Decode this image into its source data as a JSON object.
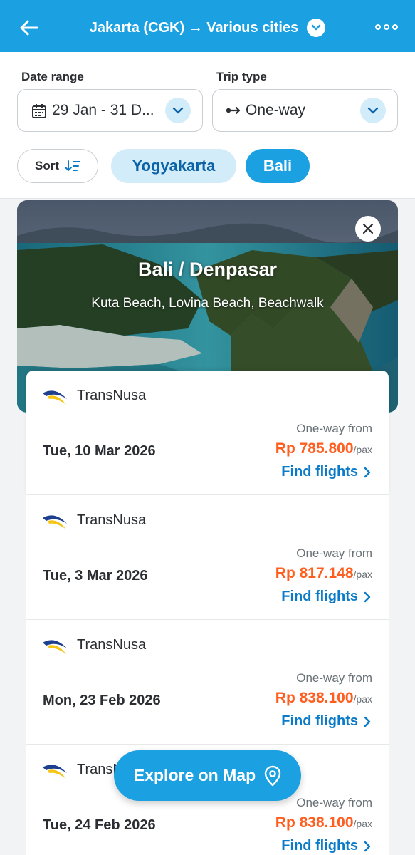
{
  "header": {
    "title": "Jakarta (CGK) → Various cities",
    "back_icon": "arrow-left-icon",
    "more_icon": "more-horizontal-icon",
    "bg_color": "#1ba0e2"
  },
  "filters": {
    "date_range_label": "Date range",
    "date_range_value": "29 Jan - 31 D...",
    "trip_type_label": "Trip type",
    "trip_type_value": "One-way",
    "sort_label": "Sort",
    "chips": [
      "Yogyakarta",
      "Bali"
    ],
    "selected_chip": "Bali"
  },
  "destination": {
    "title": "Bali / Denpasar",
    "subtitle": "Kuta Beach, Lovina Beach, Beachwalk"
  },
  "results": [
    {
      "airline": "TransNusa",
      "date": "Tue, 10 Mar 2026",
      "from_label": "One-way from",
      "price": "Rp 785.800",
      "per": "/pax",
      "cta": "Find flights"
    },
    {
      "airline": "TransNusa",
      "date": "Tue, 3 Mar 2026",
      "from_label": "One-way from",
      "price": "Rp 817.148",
      "per": "/pax",
      "cta": "Find flights"
    },
    {
      "airline": "TransNusa",
      "date": "Mon, 23 Feb 2026",
      "from_label": "One-way from",
      "price": "Rp 838.100",
      "per": "/pax",
      "cta": "Find flights"
    },
    {
      "airline": "TransNusa",
      "date": "Tue, 24 Feb 2026",
      "from_label": "One-way from",
      "price": "Rp 838.100",
      "per": "/pax",
      "cta": "Find flights"
    }
  ],
  "map_button": {
    "label": "Explore on Map",
    "icon": "map-pin-icon"
  },
  "colors": {
    "accent": "#1ba0e2",
    "price": "#ff5e1f",
    "link": "#0b7bc9",
    "chip_light": "#d3ecfa"
  }
}
